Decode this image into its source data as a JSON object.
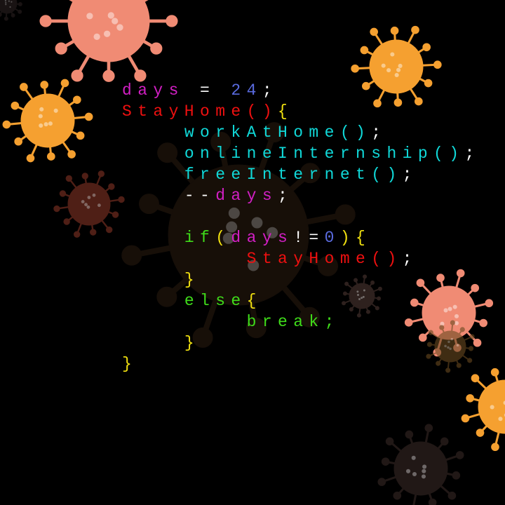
{
  "colors": {
    "background": "#000000",
    "variable": "#d21fc4",
    "number": "#5a6be0",
    "function": "#ee1010",
    "call": "#10d8d8",
    "keyword": "#3fdc1a",
    "brace": "#f0e010",
    "punct": "#ffffff"
  },
  "viruses": [
    {
      "color": "#f08b74"
    },
    {
      "color": "#f5a030"
    },
    {
      "color": "#f5a030"
    },
    {
      "color": "#6a2a1e"
    },
    {
      "color": "#2a1c10"
    },
    {
      "color": "#f08b74"
    },
    {
      "color": "#f5a030"
    },
    {
      "color": "#2a1e1c"
    },
    {
      "color": "#3a2a26"
    },
    {
      "color": "#6a4a20"
    },
    {
      "color": "#2a2020"
    }
  ],
  "code": {
    "lines": [
      {
        "indent": 0,
        "tokens": [
          [
            "days",
            "variable"
          ],
          [
            " = ",
            "punct"
          ],
          [
            "24",
            "number"
          ],
          [
            ";",
            "punct"
          ]
        ]
      },
      {
        "indent": 0,
        "tokens": [
          [
            "StayHome()",
            "function"
          ],
          [
            "{",
            "brace"
          ]
        ]
      },
      {
        "indent": 4,
        "tokens": [
          [
            "workAtHome()",
            "call"
          ],
          [
            ";",
            "punct"
          ]
        ]
      },
      {
        "indent": 4,
        "tokens": [
          [
            "onlineInternship()",
            "call"
          ],
          [
            ";",
            "punct"
          ]
        ]
      },
      {
        "indent": 4,
        "tokens": [
          [
            "freeInternet()",
            "call"
          ],
          [
            ";",
            "punct"
          ]
        ]
      },
      {
        "indent": 4,
        "tokens": [
          [
            "--",
            "punct"
          ],
          [
            "days",
            "variable"
          ],
          [
            ";",
            "punct"
          ]
        ]
      },
      {
        "indent": 0,
        "tokens": []
      },
      {
        "indent": 4,
        "tokens": [
          [
            "if",
            "keyword"
          ],
          [
            "(",
            "brace"
          ],
          [
            "days",
            "variable"
          ],
          [
            "!=",
            "punct"
          ],
          [
            "0",
            "number"
          ],
          [
            ")",
            "brace"
          ],
          [
            "{",
            "brace"
          ]
        ]
      },
      {
        "indent": 8,
        "tokens": [
          [
            "StayHome()",
            "function"
          ],
          [
            ";",
            "punct"
          ]
        ]
      },
      {
        "indent": 4,
        "tokens": [
          [
            "}",
            "brace"
          ]
        ]
      },
      {
        "indent": 4,
        "tokens": [
          [
            "else",
            "keyword"
          ],
          [
            "{",
            "brace"
          ]
        ]
      },
      {
        "indent": 8,
        "tokens": [
          [
            "break;",
            "keyword"
          ]
        ]
      },
      {
        "indent": 4,
        "tokens": [
          [
            "}",
            "brace"
          ]
        ]
      },
      {
        "indent": 0,
        "tokens": [
          [
            "}",
            "brace"
          ]
        ]
      }
    ]
  }
}
